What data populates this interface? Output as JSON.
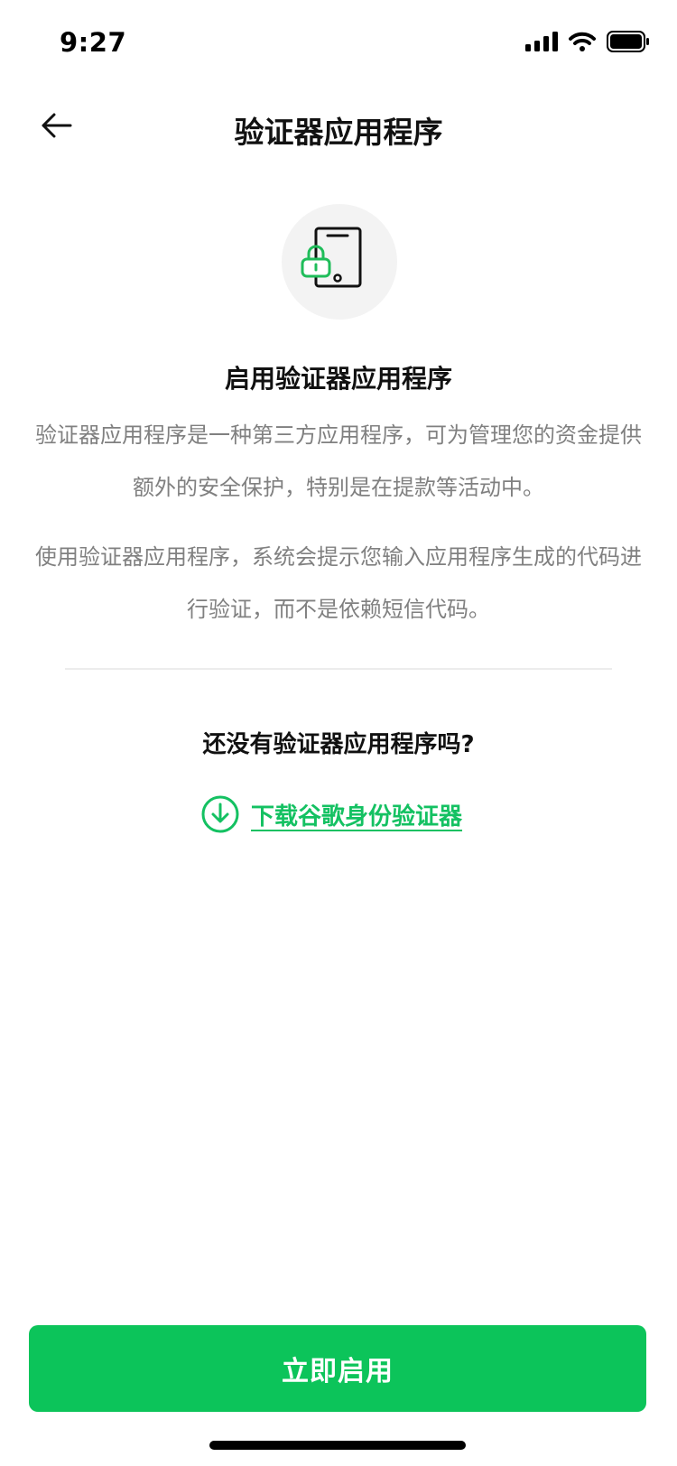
{
  "status_bar": {
    "time": "9:27",
    "icons": [
      "signal-icon",
      "wifi-icon",
      "battery-icon"
    ]
  },
  "nav": {
    "title": "验证器应用程序",
    "back_icon": "arrow-left-icon"
  },
  "hero": {
    "icon": "phone-lock-icon",
    "title": "启用验证器应用程序"
  },
  "description": {
    "paragraph_1": "验证器应用程序是一种第三方应用程序，可为管理您的资金提供额外的安全保护，特别是在提款等活动中。",
    "paragraph_2": "使用验证器应用程序，系统会提示您输入应用程序生成的代码进行验证，而不是依赖短信代码。"
  },
  "download": {
    "question": "还没有验证器应用程序吗?",
    "link_label": "下载谷歌身份验证器",
    "icon": "download-circle-icon"
  },
  "actions": {
    "enable_label": "立即启用"
  },
  "colors": {
    "accent": "#0cc45a",
    "link": "#14c162",
    "text_primary": "#111111",
    "text_secondary": "#808080",
    "hero_bg": "#f3f3f3"
  }
}
